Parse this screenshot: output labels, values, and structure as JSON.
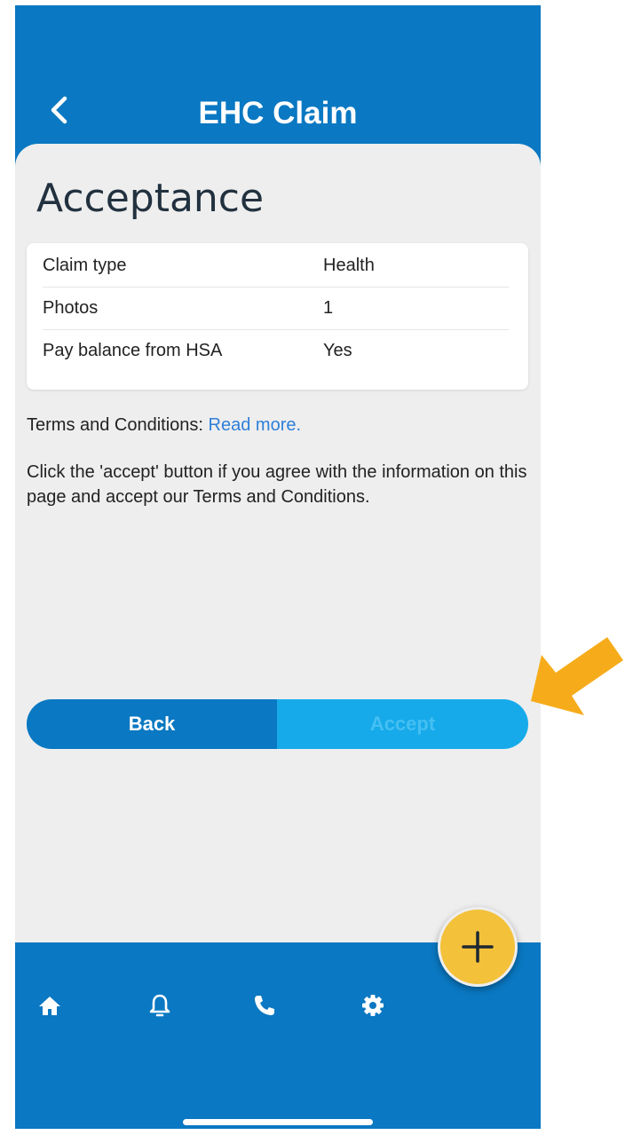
{
  "header": {
    "title": "EHC Claim"
  },
  "page": {
    "title": "Acceptance"
  },
  "summary": {
    "rows": [
      {
        "label": "Claim type",
        "value": "Health"
      },
      {
        "label": "Photos",
        "value": "1"
      },
      {
        "label": "Pay balance from HSA",
        "value": "Yes"
      }
    ]
  },
  "terms": {
    "prefix": "Terms and Conditions: ",
    "link": "Read more."
  },
  "instructions": "Click the 'accept' button if you agree with the information on this page and accept our Terms and Conditions.",
  "buttons": {
    "back": "Back",
    "accept": "Accept"
  },
  "bottom_nav": {
    "items": [
      "home-icon",
      "bell-icon",
      "phone-icon",
      "gear-icon"
    ]
  },
  "fab": {
    "icon": "plus-icon"
  },
  "colors": {
    "primary": "#0a78c2",
    "accept": "#17aaea",
    "fab": "#f3c13a",
    "annotation_arrow": "#f6ac1a",
    "link": "#2f7fd9"
  }
}
